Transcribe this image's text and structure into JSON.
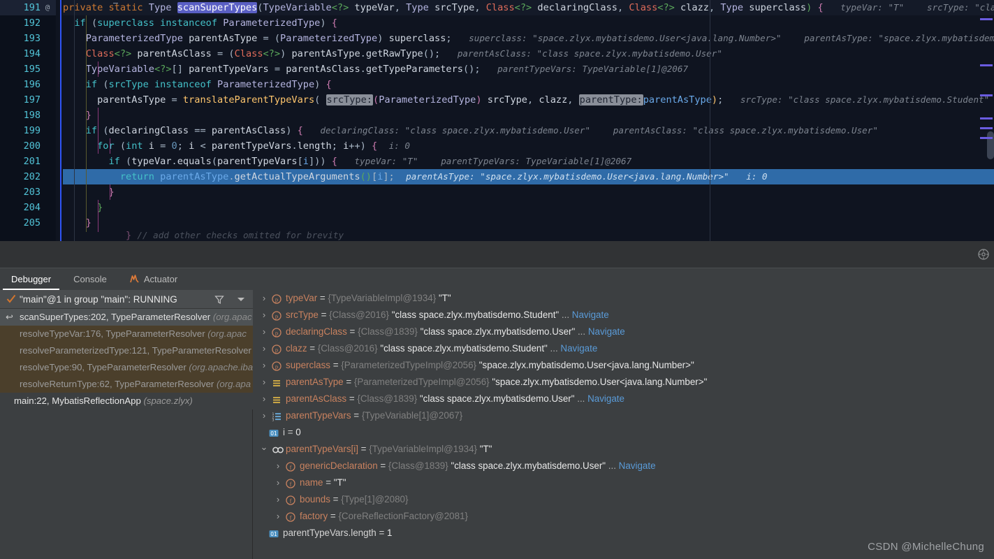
{
  "editor": {
    "first_line": 191,
    "caret_line": 202,
    "annotation_marker": "@",
    "lines": [
      {
        "num": 191,
        "at": true
      },
      {
        "num": 192
      },
      {
        "num": 193
      },
      {
        "num": 194
      },
      {
        "num": 195
      },
      {
        "num": 196
      },
      {
        "num": 197
      },
      {
        "num": 198
      },
      {
        "num": 199
      },
      {
        "num": 200
      },
      {
        "num": 201
      },
      {
        "num": 202
      },
      {
        "num": 203
      },
      {
        "num": 204
      },
      {
        "num": 205
      }
    ],
    "code": {
      "l191": "private static Type scanSuperTypes(TypeVariable<?> typeVar, Type srcType, Class<?> declaringClass, Class<?> clazz, Type superclass) {",
      "l191_sel": "scanSuperTypes",
      "l192": "if (superclass instanceof ParameterizedType) {",
      "l193": "ParameterizedType parentAsType = (ParameterizedType) superclass;",
      "l194": "Class<?> parentAsClass = (Class<?>) parentAsType.getRawType();",
      "l195": "TypeVariable<?>[] parentTypeVars = parentAsClass.getTypeParameters();",
      "l196": "if (srcType instanceof ParameterizedType) {",
      "l197": "parentAsType = translateParentTypeVars( srcType: (ParameterizedType) srcType, clazz, parentType: parentAsType);",
      "l197_param1": "srcType:",
      "l197_param2": "parentType:",
      "l198": "}",
      "l199": "if (declaringClass == parentAsClass) {",
      "l200": "for (int i = 0; i < parentTypeVars.length; i++) {",
      "l201": "if (typeVar.equals(parentTypeVars[i])) {",
      "l202": "return parentAsType.getActualTypeArguments()[i];",
      "l203": "}",
      "l204": "}",
      "l205": "}"
    },
    "inline_hints": {
      "l191_a": "typeVar: \"T\"",
      "l191_b": "srcType: \"class space.zlyx.mybatisdemo.Student\"",
      "l193_a": "superclass: \"space.zlyx.mybatisdemo.User<java.lang.Number>\"",
      "l193_b": "parentAsType: \"space.zlyx.mybatisdemo.User<java.lang.Number>\"",
      "l194_a": "parentAsClass: \"class space.zlyx.mybatisdemo.User\"",
      "l195_a": "parentTypeVars: TypeVariable[1]@2067",
      "l197_a": "srcType: \"class space.zlyx.mybatisdemo.Student\"",
      "l199_a": "declaringClass: \"class space.zlyx.mybatisdemo.User\"",
      "l199_b": "parentAsClass: \"class space.zlyx.mybatisdemo.User\"",
      "l200_a": "i: 0",
      "l201_a": "typeVar: \"T\"",
      "l201_b": "parentTypeVars: TypeVariable[1]@2067",
      "l202_a": "parentAsType: \"space.zlyx.mybatisdemo.User<java.lang.Number>\"",
      "l202_b": "i: 0"
    }
  },
  "tabs": [
    {
      "label": "Debugger",
      "active": true,
      "icon": ""
    },
    {
      "label": "Console",
      "active": false,
      "icon": ""
    },
    {
      "label": "Actuator",
      "active": false,
      "icon": "actuator-icon"
    }
  ],
  "threads": {
    "selected": "\"main\"@1 in group \"main\": RUNNING",
    "status_icon": "check-icon",
    "filter_icon": "filter-icon",
    "dropdown_icon": "chevron-down-icon"
  },
  "frames": [
    {
      "method": "scanSuperTypes:202, TypeParameterResolver",
      "pkg": "(org.apac",
      "state": "current"
    },
    {
      "method": "resolveTypeVar:176, TypeParameterResolver",
      "pkg": "(org.apac",
      "state": "lib"
    },
    {
      "method": "resolveParameterizedType:121, TypeParameterResolver",
      "pkg": "",
      "state": "lib"
    },
    {
      "method": "resolveType:90, TypeParameterResolver",
      "pkg": "(org.apache.iba",
      "state": "lib"
    },
    {
      "method": "resolveReturnType:62, TypeParameterResolver",
      "pkg": "(org.apa",
      "state": "lib"
    },
    {
      "method": "main:22, MybatisReflectionApp",
      "pkg": "(space.zlyx)",
      "state": "app"
    }
  ],
  "variables": [
    {
      "indent": 0,
      "toggle": "collapsed",
      "icon": "parameter-icon",
      "name": "typeVar",
      "type": "{TypeVariableImpl@1934}",
      "value": "\"T\"",
      "navigate": false
    },
    {
      "indent": 0,
      "toggle": "collapsed",
      "icon": "parameter-icon",
      "name": "srcType",
      "type": "{Class@2016}",
      "value": "\"class space.zlyx.mybatisdemo.Student\"",
      "navigate": true
    },
    {
      "indent": 0,
      "toggle": "collapsed",
      "icon": "parameter-icon",
      "name": "declaringClass",
      "type": "{Class@1839}",
      "value": "\"class space.zlyx.mybatisdemo.User\"",
      "navigate": true
    },
    {
      "indent": 0,
      "toggle": "collapsed",
      "icon": "parameter-icon",
      "name": "clazz",
      "type": "{Class@2016}",
      "value": "\"class space.zlyx.mybatisdemo.Student\"",
      "navigate": true
    },
    {
      "indent": 0,
      "toggle": "collapsed",
      "icon": "parameter-icon",
      "name": "superclass",
      "type": "{ParameterizedTypeImpl@2056}",
      "value": "\"space.zlyx.mybatisdemo.User<java.lang.Number>\"",
      "navigate": false
    },
    {
      "indent": 0,
      "toggle": "collapsed",
      "icon": "local-var-icon",
      "name": "parentAsType",
      "type": "{ParameterizedTypeImpl@2056}",
      "value": "\"space.zlyx.mybatisdemo.User<java.lang.Number>\"",
      "navigate": false
    },
    {
      "indent": 0,
      "toggle": "collapsed",
      "icon": "local-var-icon",
      "name": "parentAsClass",
      "type": "{Class@1839}",
      "value": "\"class space.zlyx.mybatisdemo.User\"",
      "navigate": true
    },
    {
      "indent": 0,
      "toggle": "collapsed",
      "icon": "array-icon",
      "name": "parentTypeVars",
      "type": "{TypeVariable[1]@2067}",
      "value": "",
      "navigate": false
    },
    {
      "indent": 0,
      "toggle": "none",
      "icon": "primitive-icon",
      "name": "i",
      "type": "",
      "value": "0",
      "plain": true,
      "navigate": false
    },
    {
      "indent": 0,
      "toggle": "expanded",
      "icon": "link-icon",
      "name": "parentTypeVars[i]",
      "type": "{TypeVariableImpl@1934}",
      "value": "\"T\"",
      "navigate": false
    },
    {
      "indent": 1,
      "toggle": "collapsed",
      "icon": "field-icon",
      "name": "genericDeclaration",
      "type": "{Class@1839}",
      "value": "\"class space.zlyx.mybatisdemo.User\"",
      "navigate": true
    },
    {
      "indent": 1,
      "toggle": "collapsed",
      "icon": "field-icon",
      "name": "name",
      "type": "",
      "value": "\"T\"",
      "navigate": false
    },
    {
      "indent": 1,
      "toggle": "collapsed",
      "icon": "field-icon",
      "name": "bounds",
      "type": "{Type[1]@2080}",
      "value": "",
      "navigate": false
    },
    {
      "indent": 1,
      "toggle": "collapsed",
      "icon": "field-icon",
      "name": "factory",
      "type": "{CoreReflectionFactory@2081}",
      "value": "",
      "navigate": false
    },
    {
      "indent": 0,
      "toggle": "none",
      "icon": "primitive-icon",
      "name": "parentTypeVars.length",
      "type": "",
      "value": "1",
      "plain": true,
      "navigate": false
    }
  ],
  "watermark": "CSDN @MichelleChung",
  "colors": {
    "editor_bg": "#0f1420",
    "panel_bg": "#3c3f41",
    "caret_row": "#2f6ba8",
    "accent": "#5a9bd8",
    "param_icon": "#c9825f",
    "local_icon": "#c8a545",
    "marker": "#6a5ce0"
  }
}
